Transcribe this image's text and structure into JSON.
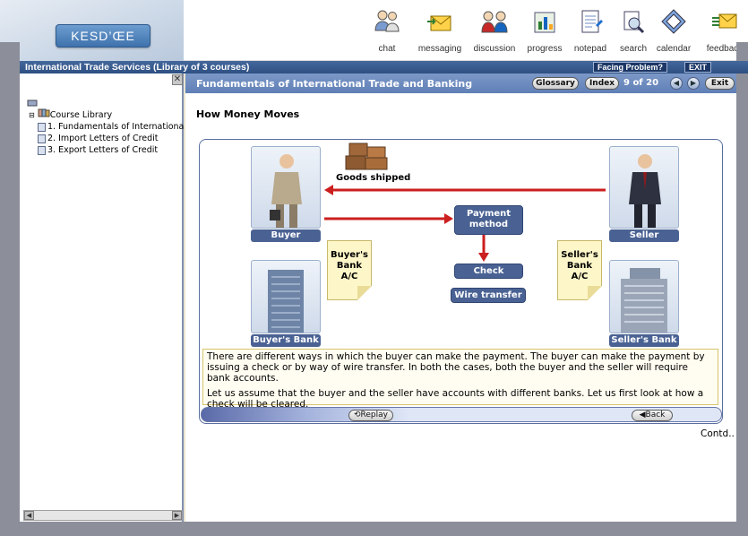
{
  "brand": {
    "logo_text": "KESD’ŒE"
  },
  "toolbar": [
    {
      "label": "chat",
      "icon": "chat-icon"
    },
    {
      "label": "messaging",
      "icon": "messaging-icon"
    },
    {
      "label": "discussion",
      "icon": "discussion-icon"
    },
    {
      "label": "progress",
      "icon": "progress-icon"
    },
    {
      "label": "notepad",
      "icon": "notepad-icon"
    },
    {
      "label": "search",
      "icon": "search-icon"
    },
    {
      "label": "calendar",
      "icon": "calendar-icon"
    },
    {
      "label": "feedback",
      "icon": "feedback-icon"
    }
  ],
  "titlebar": {
    "title": "International Trade Services (Library of 3 courses)",
    "facing_problem": "Facing Problem?",
    "exit": "EXIT"
  },
  "tree": {
    "root": "Course Library",
    "items": [
      "1. Fundamentals of Internationa",
      "2. Import Letters of Credit",
      "3. Export Letters of Credit"
    ]
  },
  "content_bar": {
    "title": "Fundamentals of International Trade and Banking",
    "glossary": "Glossary",
    "index": "Index",
    "page_indicator": "9 of 20",
    "exit": "Exit"
  },
  "page": {
    "title": "How Money Moves"
  },
  "diagram": {
    "goods_label": "Goods shipped",
    "buyer": "Buyer",
    "seller": "Seller",
    "payment_method": "Payment method",
    "check": "Check",
    "wire_transfer": "Wire transfer",
    "buyers_bank_ac": "Buyer's Bank A/C",
    "sellers_bank_ac": "Seller's Bank A/C",
    "buyers_bank": "Buyer's Bank",
    "sellers_bank": "Seller's Bank"
  },
  "description": {
    "p1": "There are different ways in which the buyer can make the payment. The buyer can make the payment by issuing a check or by way of wire transfer. In both the cases, both the buyer and the seller will require bank accounts.",
    "p2": "Let us assume that the buyer and the seller have accounts with different banks. Let us first look at how a check will be cleared."
  },
  "nav": {
    "replay": "Replay",
    "back": "Back",
    "contd": "Contd.."
  },
  "colors": {
    "accent": "#4a6293",
    "arrow": "#cc1f1f",
    "note": "#fdf6c8"
  }
}
